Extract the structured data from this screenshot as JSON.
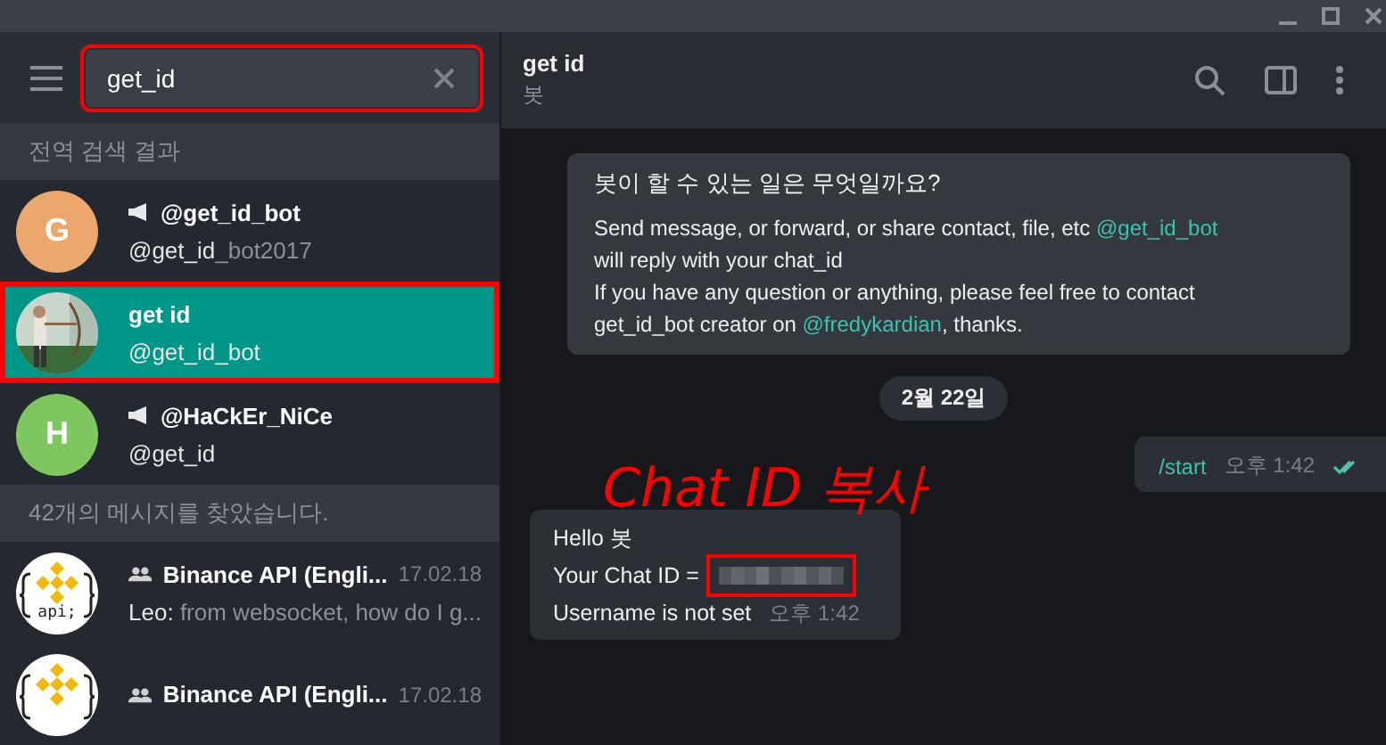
{
  "search": {
    "value": "get_id",
    "highlighted": true
  },
  "sections": [
    {
      "title": "전역 검색 결과",
      "kind": "global"
    },
    {
      "title": "42개의 메시지를 찾았습니다.",
      "kind": "messages"
    }
  ],
  "global_results": [
    {
      "name": "@get_id_bot",
      "subtitle_match": "@get_id",
      "subtitle_rest": "_bot2017",
      "letter": "G",
      "color": "#eca86c",
      "channel": true,
      "selected": false,
      "highlighted": false
    },
    {
      "name": "get id",
      "subtitle_match": "@get_id_bot",
      "kind": "picture",
      "channel": false,
      "selected": true,
      "highlighted": true
    },
    {
      "name": "@HaCkEr_NiCe",
      "subtitle_match": "@get_id",
      "letter": "H",
      "color": "#7ec65e",
      "channel": true,
      "selected": false,
      "highlighted": false
    }
  ],
  "message_results": [
    {
      "name": "Binance API (Engli...",
      "date": "17.02.18",
      "sender": "Leo:",
      "preview": "from websocket, how do I g...",
      "logo_text": "api;"
    },
    {
      "name": "Binance API (Engli...",
      "date": "17.02.18"
    }
  ],
  "chat": {
    "title": "get id",
    "status": "봇"
  },
  "messages": [
    {
      "kind": "bot_info",
      "title": "봇이 할 수 있는 일은 무엇일까요?",
      "lines": [
        {
          "text": "Send message, or forward, or share contact, file, etc ",
          "link": "@get_id_bot"
        },
        {
          "text": "will reply with your chat_id"
        },
        {
          "text": "If you have any question or anything, please feel free to contact"
        },
        {
          "text": "get_id_bot creator on ",
          "link": "@fredykardian",
          "after": ", thanks."
        }
      ]
    },
    {
      "kind": "date",
      "text": "2월 22일"
    },
    {
      "kind": "outgoing",
      "text": "/start",
      "time": "오후 1:42",
      "read": true
    },
    {
      "kind": "incoming",
      "lines": [
        "Hello 봇",
        "Your Chat ID ="
      ],
      "last_line": "Username is not set",
      "redacted": true,
      "highlighted": true,
      "time": "오후 1:42"
    }
  ],
  "annotation": "Chat ID 복사"
}
